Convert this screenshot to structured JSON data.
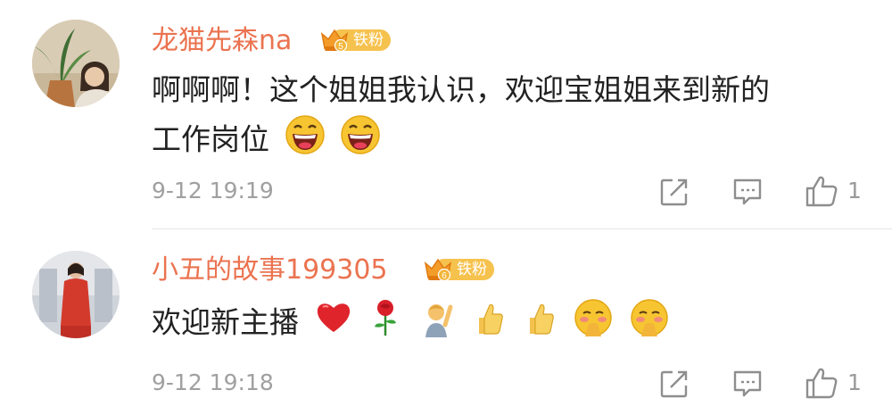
{
  "comments": [
    {
      "username": "龙猫先森na",
      "badge_level": "5",
      "badge_label": "铁粉",
      "text_line1": "啊啊啊！这个姐姐我认识，欢迎宝姐姐来到新的",
      "text_line2": "工作岗位",
      "emojis": [
        "laughing-face",
        "laughing-face"
      ],
      "time": "9-12 19:19",
      "like_count": "1"
    },
    {
      "username": "小五的故事199305",
      "badge_level": "6",
      "badge_label": "铁粉",
      "text_line1": "欢迎新主播",
      "emojis": [
        "red-heart",
        "rose",
        "person-raising-hand",
        "thumbs-up",
        "thumbs-up",
        "shy-face",
        "shy-face"
      ],
      "time": "9-12 19:18",
      "like_count": "1"
    }
  ],
  "colors": {
    "username": "#eb7350",
    "badge": "#f6c24e",
    "text": "#222222",
    "meta": "#a0a0a0"
  }
}
